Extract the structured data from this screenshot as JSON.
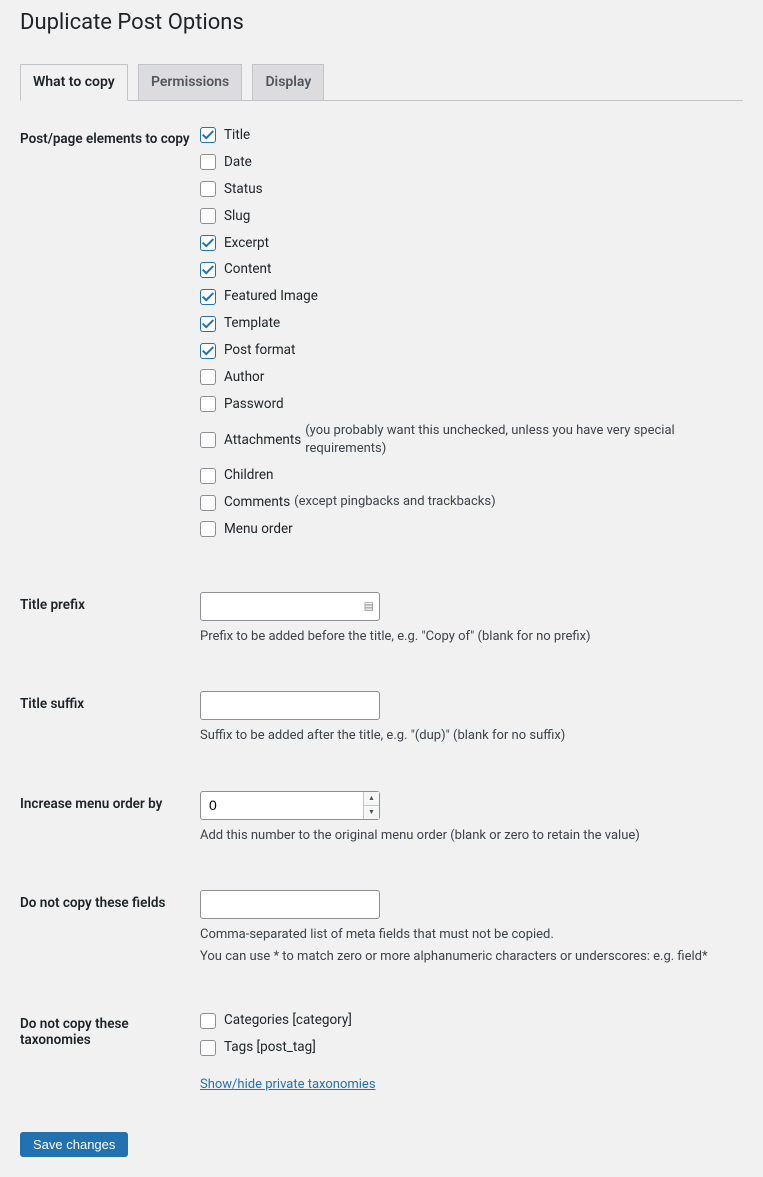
{
  "page_title": "Duplicate Post Options",
  "tabs": [
    {
      "label": "What to copy",
      "active": true
    },
    {
      "label": "Permissions",
      "active": false
    },
    {
      "label": "Display",
      "active": false
    }
  ],
  "elements_label": "Post/page elements to copy",
  "elements": [
    {
      "label": "Title",
      "checked": true,
      "hint": ""
    },
    {
      "label": "Date",
      "checked": false,
      "hint": ""
    },
    {
      "label": "Status",
      "checked": false,
      "hint": ""
    },
    {
      "label": "Slug",
      "checked": false,
      "hint": ""
    },
    {
      "label": "Excerpt",
      "checked": true,
      "hint": ""
    },
    {
      "label": "Content",
      "checked": true,
      "hint": ""
    },
    {
      "label": "Featured Image",
      "checked": true,
      "hint": ""
    },
    {
      "label": "Template",
      "checked": true,
      "hint": ""
    },
    {
      "label": "Post format",
      "checked": true,
      "hint": ""
    },
    {
      "label": "Author",
      "checked": false,
      "hint": ""
    },
    {
      "label": "Password",
      "checked": false,
      "hint": ""
    },
    {
      "label": "Attachments",
      "checked": false,
      "hint": "(you probably want this unchecked, unless you have very special requirements)"
    },
    {
      "label": "Children",
      "checked": false,
      "hint": ""
    },
    {
      "label": "Comments",
      "checked": false,
      "hint": "(except pingbacks and trackbacks)"
    },
    {
      "label": "Menu order",
      "checked": false,
      "hint": ""
    }
  ],
  "title_prefix": {
    "label": "Title prefix",
    "value": "",
    "desc": "Prefix to be added before the title, e.g. \"Copy of\" (blank for no prefix)"
  },
  "title_suffix": {
    "label": "Title suffix",
    "value": "",
    "desc": "Suffix to be added after the title, e.g. \"(dup)\" (blank for no suffix)"
  },
  "menu_order": {
    "label": "Increase menu order by",
    "value": "0",
    "desc": "Add this number to the original menu order (blank or zero to retain the value)"
  },
  "blacklist": {
    "label": "Do not copy these fields",
    "value": "",
    "desc1": "Comma-separated list of meta fields that must not be copied.",
    "desc2": "You can use * to match zero or more alphanumeric characters or underscores: e.g. field*"
  },
  "taxonomies": {
    "label": "Do not copy these taxonomies",
    "items": [
      {
        "label": "Categories [category]",
        "checked": false
      },
      {
        "label": "Tags [post_tag]",
        "checked": false
      }
    ],
    "toggle": "Show/hide private taxonomies"
  },
  "save_label": "Save changes"
}
